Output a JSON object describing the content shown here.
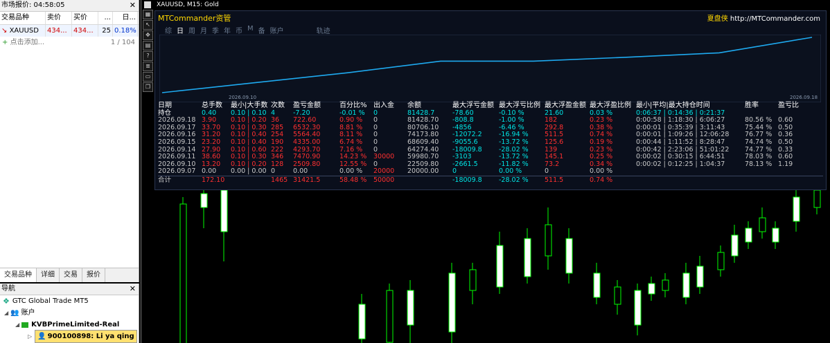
{
  "market_watch": {
    "title": "市场报价: 04:58:05",
    "columns": [
      "交易品种",
      "卖价",
      "买价",
      "...",
      "日..."
    ],
    "row": {
      "symbol": "XAUUSD",
      "bid": "434...",
      "ask": "434...",
      "spread": "25",
      "change": "0.18%"
    },
    "add_label": "点击添加...",
    "count": "1 / 104",
    "tabs": [
      "交易品种",
      "详细",
      "交易",
      "报价"
    ]
  },
  "navigator": {
    "title": "导航",
    "items": [
      "GTC Global Trade MT5",
      "账户",
      "KVBPrimeLimited-Real",
      "900100898: Li ya qing"
    ]
  },
  "chart": {
    "title": "XAUUSD, M15:  Gold",
    "toolbar_icons": [
      "grid-icon",
      "arrow-icon",
      "move-icon",
      "file-icon",
      "question-icon",
      "list-icon",
      "window-icon",
      "restore-icon"
    ],
    "colors": {
      "up": "#00ff00",
      "body": "#ffffff",
      "down": "#000000"
    }
  },
  "panel": {
    "title": "MTCommander资管",
    "brand": "夏盘侠",
    "url": "http://MTCommander.com",
    "periods": [
      "综",
      "日",
      "周",
      "月",
      "季",
      "年",
      "币",
      "M",
      "备",
      "账户"
    ],
    "selected_period": "日",
    "track_label": "轨迹",
    "curve_start_label": "2026.09.10",
    "curve_end_label": "2026.09.18",
    "curve_color": "#1eaaf0",
    "curve_values": [
      0,
      18,
      36,
      57,
      57,
      64,
      72,
      100
    ],
    "headers": [
      "日期",
      "总手数",
      "最小|大手数",
      "次数",
      "盈亏金额",
      "百分比%",
      "出入金",
      "余额",
      "最大浮亏金额",
      "最大浮亏比例",
      "最大浮盈金额",
      "最大浮盈比例",
      "最小|平均|最大持仓时间",
      "胜率",
      "盈亏比"
    ],
    "holding": [
      "持仓",
      "0.40",
      "0.10 | 0.10",
      "4",
      "-7.20",
      "-0.01 %",
      "0",
      "81428.7",
      "-78.60",
      "-0.10 %",
      "21.60",
      "0.03 %",
      "0:06:37 | 0:14:36 | 0:21:37",
      "",
      ""
    ],
    "rows": [
      [
        "2026.09.18",
        "3.90",
        "0.10 | 0.20",
        "36",
        "722.60",
        "0.90 %",
        "0",
        "81428.70",
        "-808.8",
        "-1.00 %",
        "182",
        "0.23 %",
        "0:00:58 | 1:18:30 | 6:06:27",
        "80.56 %",
        "0.60"
      ],
      [
        "2026.09.17",
        "33.70",
        "0.10 | 0.30",
        "285",
        "6532.30",
        "8.81 %",
        "0",
        "80706.10",
        "-4856",
        "-6.46 %",
        "292.8",
        "0.38 %",
        "0:00:01 | 0:35:39 | 3:11:43",
        "75.44 %",
        "0.50"
      ],
      [
        "2026.09.16",
        "31.20",
        "0.10 | 0.40",
        "254",
        "5564.40",
        "8.11 %",
        "0",
        "74173.80",
        "-12072.2",
        "-16.94 %",
        "511.5",
        "0.74 %",
        "0:00:01 | 1:09:26 | 12:06:28",
        "76.77 %",
        "0.36"
      ],
      [
        "2026.09.15",
        "23.20",
        "0.10 | 0.40",
        "190",
        "4335.00",
        "6.74 %",
        "0",
        "68609.40",
        "-9055.6",
        "-13.72 %",
        "125.6",
        "0.19 %",
        "0:00:44 | 1:11:52 | 8:28:47",
        "74.74 %",
        "0.50"
      ],
      [
        "2026.09.14",
        "27.90",
        "0.10 | 0.60",
        "222",
        "4293.70",
        "7.16 %",
        "0",
        "64274.40",
        "-18009.8",
        "-28.02 %",
        "139",
        "0.23 %",
        "0:00:42 | 2:23:06 | 51:01:22",
        "74.77 %",
        "0.33"
      ],
      [
        "2026.09.11",
        "38.60",
        "0.10 | 0.30",
        "346",
        "7470.90",
        "14.23 %",
        "30000",
        "59980.70",
        "-3103",
        "-13.72 %",
        "145.1",
        "0.25 %",
        "0:00:02 | 0:30:15 | 6:44:51",
        "78.03 %",
        "0.60"
      ],
      [
        "2026.09.10",
        "13.20",
        "0.10 | 0.20",
        "128",
        "2509.80",
        "12.55 %",
        "0",
        "22509.80",
        "-2661.5",
        "-11.82 %",
        "73.2",
        "0.34 %",
        "0:00:02 | 0:12:25 | 1:04:37",
        "78.13 %",
        "1.19"
      ],
      [
        "2026.09.07",
        "0.00",
        "0.00 | 0.00",
        "0",
        "0.00",
        "0.00 %",
        "20000",
        "20000.00",
        "0",
        "0.00 %",
        "0",
        "0.00 %",
        "",
        "",
        ""
      ]
    ],
    "total": [
      "合计",
      "172.10",
      "",
      "1465",
      "31421.5",
      "58.48 %",
      "50000",
      "",
      "-18009.8",
      "-28.02 %",
      "511.5",
      "0.74 %",
      "",
      "",
      ""
    ]
  }
}
